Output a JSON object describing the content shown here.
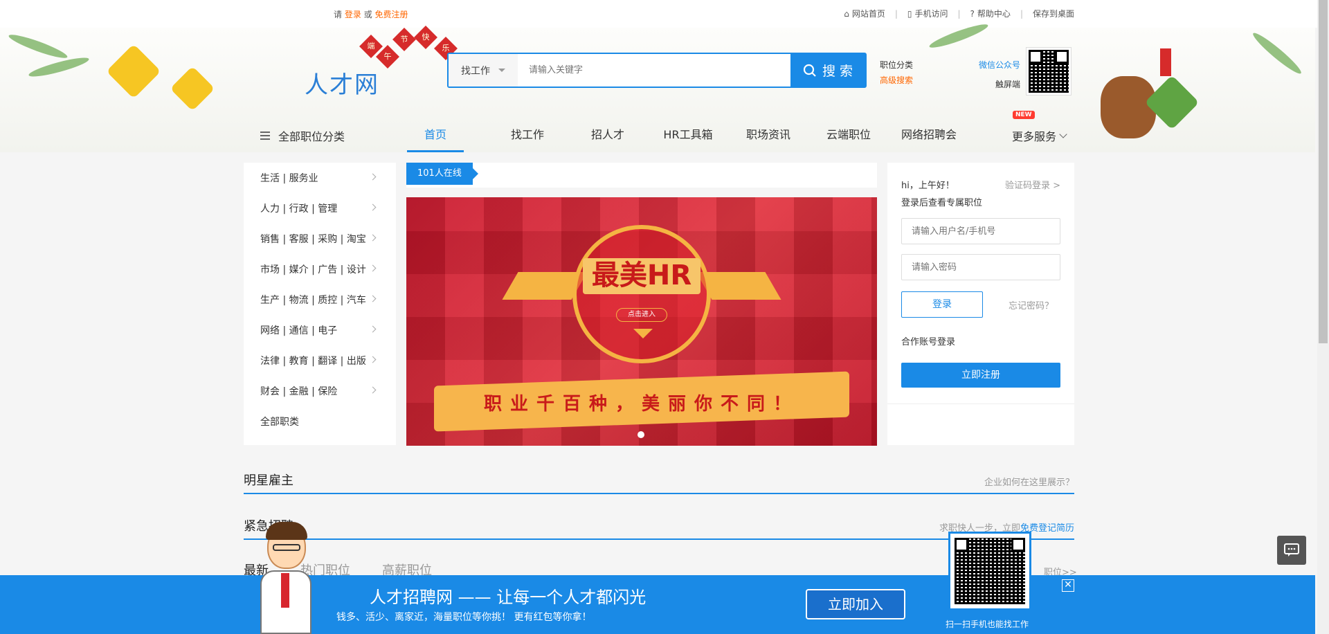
{
  "topbar": {
    "please": "请",
    "login": "登录",
    "or": "或",
    "register": "免费注册",
    "home": "网站首页",
    "mobile": "手机访问",
    "help": "帮助中心",
    "save_desktop": "保存到桌面",
    "sep": "|"
  },
  "header": {
    "logo": "人才网",
    "lanterns": [
      "端",
      "午",
      "节",
      "快",
      "乐"
    ],
    "search": {
      "select_value": "找工作",
      "placeholder": "请输入关键字",
      "button": "搜 索"
    },
    "links": {
      "job_category": "职位分类",
      "advanced_search": "高级搜索",
      "wechat": "微信公众号",
      "touch": "触屏端"
    }
  },
  "nav": {
    "all_categories": "全部职位分类",
    "items": [
      "首页",
      "找工作",
      "招人才",
      "HR工具箱",
      "职场资讯",
      "云端职位",
      "网络招聘会"
    ],
    "more": "更多服务",
    "new_badge": "NEW"
  },
  "categories": [
    "生活 | 服务业",
    "人力 | 行政 | 管理",
    "销售 | 客服 | 采购 | 淘宝",
    "市场 | 媒介 | 广告 | 设计",
    "生产 | 物流 | 质控 | 汽车",
    "网络 | 通信 | 电子",
    "法律 | 教育 | 翻译 | 出版",
    "财会 | 金融 | 保险",
    "全部职类"
  ],
  "online": "101人在线",
  "banner": {
    "title": "最美HR",
    "enter": "点击进入",
    "slogan": "职业千百种，美丽你不同！"
  },
  "login": {
    "greeting": "hi，上午好！",
    "code_login": "验证码登录 >",
    "subtitle": "登录后查看专属职位",
    "username_placeholder": "请输入用户名/手机号",
    "password_placeholder": "请输入密码",
    "login_button": "登录",
    "forgot": "忘记密码？",
    "partner": "合作账号登录",
    "register_button": "立即注册"
  },
  "sections": {
    "star_employer": "明星雇主",
    "star_employer_right": "企业如何在这里展示？",
    "urgent": "紧急招聘",
    "urgent_right_prefix": "求职快人一步，立即",
    "urgent_right_link": "免费登记简历",
    "tabs": [
      "最新",
      "热门职位",
      "高薪职位"
    ],
    "more_jobs": "职位>>"
  },
  "footer_banner": {
    "title": "人才招聘网 —— 让每一个人才都闪光",
    "subtitle": "钱多、活少、离家近，海量职位等你挑！ 更有红包等你拿！",
    "join": "立即加入",
    "close": "✕",
    "qr_label": "扫一扫手机也能找工作"
  }
}
